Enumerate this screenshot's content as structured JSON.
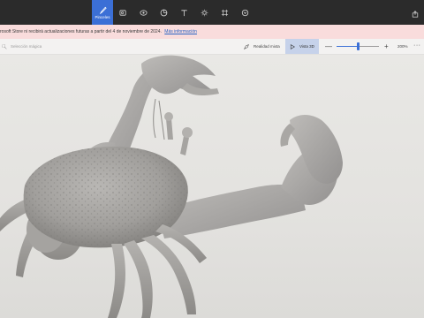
{
  "toolbar": {
    "tools": [
      {
        "icon": "brushes-icon",
        "label": "Pinceles",
        "active": true
      },
      {
        "icon": "shapes-2d-icon",
        "label": ""
      },
      {
        "icon": "shapes-3d-icon",
        "label": ""
      },
      {
        "icon": "stickers-icon",
        "label": ""
      },
      {
        "icon": "text-icon",
        "label": ""
      },
      {
        "icon": "effects-icon",
        "label": ""
      },
      {
        "icon": "canvas-icon",
        "label": ""
      },
      {
        "icon": "library-3d-icon",
        "label": ""
      }
    ],
    "share_icon": "share-icon",
    "accent": "#3b6fd6"
  },
  "notice": {
    "text": "rosoft Store ni recibirá actualizaciones futuras a partir del 4 de noviembre de 2024.",
    "link": "Más información"
  },
  "subbar": {
    "select_label": "Selección mágica",
    "mixed_reality_label": "Realidad mixta",
    "view_3d_label": "Vista 3D",
    "zoom_minus": "—",
    "zoom_plus": "+",
    "zoom_percent": "200%",
    "zoom_level": 0.5,
    "more": "···"
  },
  "canvas": {
    "model": "3D crab model",
    "model_color": "#9f9d9a"
  }
}
